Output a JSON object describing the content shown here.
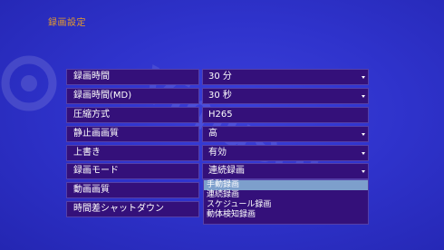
{
  "page": {
    "title": "録画設定"
  },
  "settings": [
    {
      "label": "録画時間",
      "value": "30 分",
      "has_dropdown": true
    },
    {
      "label": "録画時間(MD)",
      "value": "30 秒",
      "has_dropdown": true
    },
    {
      "label": "圧縮方式",
      "value": "H265",
      "has_dropdown": false
    },
    {
      "label": "静止画画質",
      "value": "高",
      "has_dropdown": true
    },
    {
      "label": "上書き",
      "value": "有効",
      "has_dropdown": true
    },
    {
      "label": "録画モード",
      "value": "連続録画",
      "has_dropdown": true
    },
    {
      "label": "動画画質",
      "value": "",
      "has_dropdown": false
    },
    {
      "label": "時間差シャットダウン",
      "value": "",
      "has_dropdown": false
    }
  ],
  "record_mode_dropdown": {
    "options": [
      "手動録画",
      "連続録画",
      "スケジュール録画",
      "動体検知録画"
    ],
    "highlighted_index": 0
  },
  "watermark": {
    "text": "Vimuson"
  },
  "colors": {
    "background": "#2f33cc",
    "title": "#e49a2c",
    "field_bg": "#34107a",
    "field_border": "#5540a8",
    "highlight": "#7d9fcc",
    "text": "#ffffff"
  }
}
